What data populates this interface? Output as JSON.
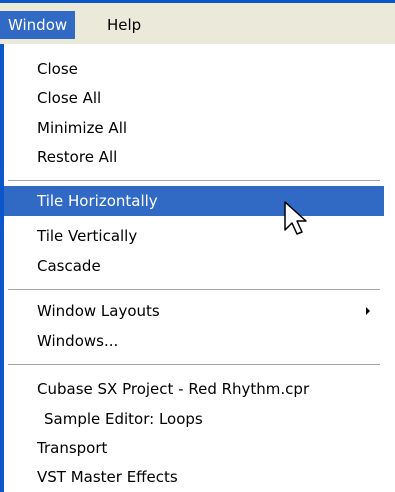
{
  "menubar": {
    "items": [
      {
        "label": "Window",
        "active": true
      },
      {
        "label": "Help",
        "active": false
      }
    ]
  },
  "window_menu": {
    "groups": [
      {
        "items": [
          {
            "label": "Close"
          },
          {
            "label": "Close All"
          },
          {
            "label": "Minimize All"
          },
          {
            "label": "Restore All"
          }
        ]
      },
      {
        "items": [
          {
            "label": "Tile Horizontally",
            "highlighted": true
          },
          {
            "label": "Tile Vertically"
          },
          {
            "label": "Cascade"
          }
        ]
      },
      {
        "items": [
          {
            "label": "Window Layouts",
            "submenu": true
          },
          {
            "label": "Windows..."
          }
        ]
      },
      {
        "items": [
          {
            "label": "Cubase SX Project - Red Rhythm.cpr"
          },
          {
            "label": "Sample Editor: Loops",
            "indented": true
          },
          {
            "label": "Transport"
          },
          {
            "label": "VST Master Effects"
          }
        ]
      }
    ]
  },
  "colors": {
    "highlight": "#316ac5",
    "menubar_bg": "#ebe9d9",
    "title_blue": "#0b56c9"
  },
  "cursor": {
    "icon": "arrow-pointer-icon"
  }
}
